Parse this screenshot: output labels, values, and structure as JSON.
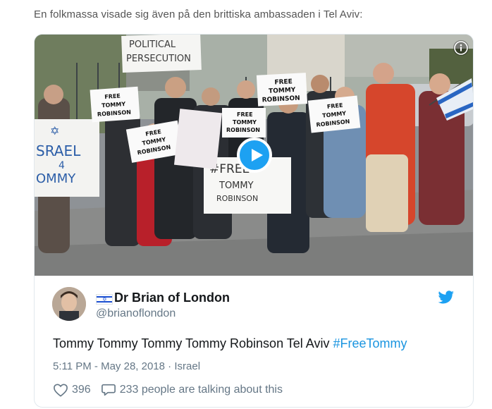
{
  "intro_text": "En folkmassa visade sig även på den brittiska ambassaden i Tel Aviv:",
  "media": {
    "signs": {
      "political": [
        "POLITICAL",
        "PERSECUTION"
      ],
      "free1": [
        "FREE",
        "TOMMY",
        "ROBINSON"
      ],
      "free2": [
        "FREE",
        "TOMMY",
        "ROBINSON"
      ],
      "free3": [
        "FREE",
        "TOMMY",
        "ROBINSON"
      ],
      "free4": [
        "FREE",
        "TOMMY",
        "ROBINSON"
      ],
      "free5": [
        "FREE",
        "TOMMY",
        "ROBINSON"
      ],
      "hash": [
        "#FREE",
        "TOMMY",
        "ROBINSON"
      ],
      "israel": [
        "SRAEL",
        "4",
        "OMMY"
      ]
    },
    "icons": {
      "info": "info-icon",
      "play": "play-icon"
    }
  },
  "tweet": {
    "display_name": "Dr Brian of London",
    "handle": "@brianoflondon",
    "text_plain": "Tommy Tommy Tommy Tommy Robinson Tel Aviv ",
    "hashtag": "#FreeTommy",
    "time": "5:11 PM",
    "date": "May 28, 2018",
    "location": "Israel",
    "likes": "396",
    "talking": "233 people are talking about this",
    "icons": {
      "bird": "twitter-bird-icon",
      "heart": "heart-icon",
      "reply": "reply-bubble-icon",
      "flag": "israel-flag-icon"
    }
  },
  "colors": {
    "accent": "#1da1f2",
    "link": "#1b95e0",
    "muted": "#657786",
    "text": "#14171a"
  }
}
